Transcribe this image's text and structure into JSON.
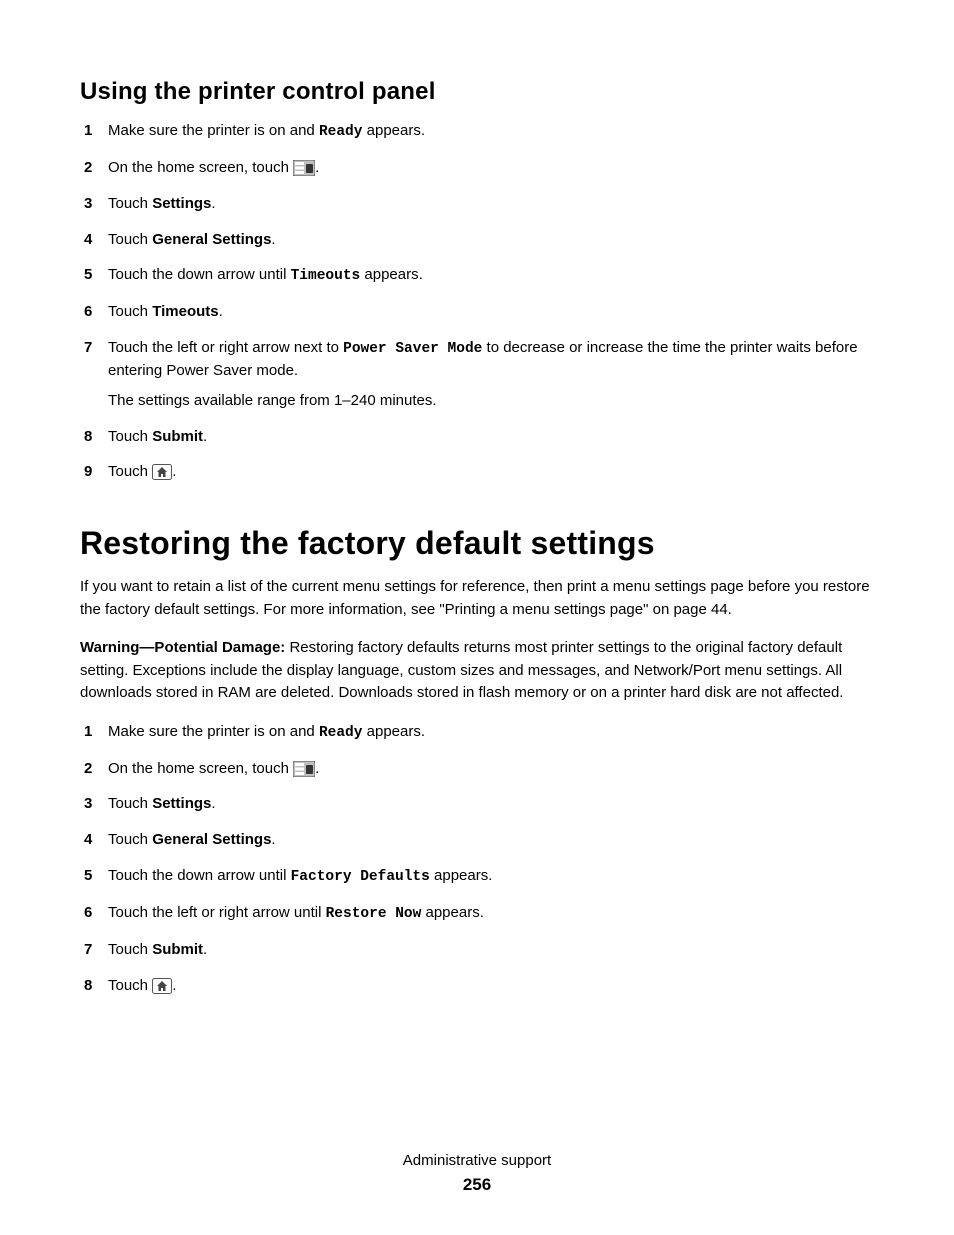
{
  "section_a": {
    "title": "Using the printer control panel",
    "steps": [
      {
        "pre": "Make sure the printer is on and ",
        "mono": "Ready",
        "post": " appears."
      },
      {
        "pre": "On the home screen, touch ",
        "icon": "menu-icon",
        "post": "."
      },
      {
        "pre": "Touch ",
        "bold": "Settings",
        "post": "."
      },
      {
        "pre": "Touch ",
        "bold": "General Settings",
        "post": "."
      },
      {
        "pre": "Touch the down arrow until ",
        "mono": "Timeouts",
        "post": " appears."
      },
      {
        "pre": "Touch ",
        "bold": "Timeouts",
        "post": "."
      },
      {
        "pre": "Touch the left or right arrow next to ",
        "mono": "Power Saver Mode",
        "post": " to decrease or increase the time the printer waits before entering Power Saver mode.",
        "extra": "The settings available range from 1–240 minutes."
      },
      {
        "pre": "Touch ",
        "bold": "Submit",
        "post": "."
      },
      {
        "pre": "Touch ",
        "icon": "home-icon",
        "post": "."
      }
    ]
  },
  "section_b": {
    "title": "Restoring the factory default settings",
    "intro": "If you want to retain a list of the current menu settings for reference, then print a menu settings page before you restore the factory default settings. For more information, see \"Printing a menu settings page\" on page 44.",
    "warning_lead": "Warning—Potential Damage: ",
    "warning_body": "Restoring factory defaults returns most printer settings to the original factory default setting. Exceptions include the display language, custom sizes and messages, and Network/Port menu settings. All downloads stored in RAM are deleted. Downloads stored in flash memory or on a printer hard disk are not affected.",
    "steps": [
      {
        "pre": "Make sure the printer is on and ",
        "mono": "Ready",
        "post": " appears."
      },
      {
        "pre": "On the home screen, touch ",
        "icon": "menu-icon",
        "post": "."
      },
      {
        "pre": "Touch ",
        "bold": "Settings",
        "post": "."
      },
      {
        "pre": "Touch ",
        "bold": "General Settings",
        "post": "."
      },
      {
        "pre": "Touch the down arrow until ",
        "mono": "Factory Defaults",
        "post": " appears."
      },
      {
        "pre": "Touch the left or right arrow until ",
        "mono": "Restore Now",
        "post": " appears."
      },
      {
        "pre": "Touch ",
        "bold": "Submit",
        "post": "."
      },
      {
        "pre": "Touch ",
        "icon": "home-icon",
        "post": "."
      }
    ]
  },
  "footer": {
    "label": "Administrative support",
    "page": "256"
  }
}
